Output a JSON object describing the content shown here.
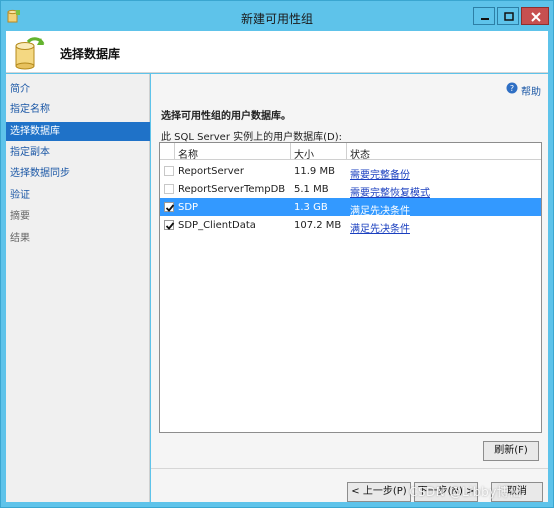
{
  "window": {
    "title": "新建可用性组"
  },
  "header": {
    "title": "选择数据库"
  },
  "sidebar": {
    "items": [
      {
        "label": "简介",
        "state": "link"
      },
      {
        "label": "指定名称",
        "state": "link"
      },
      {
        "label": "选择数据库",
        "state": "selected"
      },
      {
        "label": "指定副本",
        "state": "link"
      },
      {
        "label": "选择数据同步",
        "state": "link"
      },
      {
        "label": "验证",
        "state": "link"
      },
      {
        "label": "摘要",
        "state": "disabled"
      },
      {
        "label": "结果",
        "state": "disabled"
      }
    ]
  },
  "main": {
    "help_label": "帮助",
    "heading": "选择可用性组的用户数据库。",
    "grid_label": "此 SQL Server 实例上的用户数据库(D):",
    "columns": {
      "name": "名称",
      "size": "大小",
      "status": "状态"
    },
    "rows": [
      {
        "checked": false,
        "enabled": false,
        "name": "ReportServer",
        "size": "11.9 MB",
        "status": "需要完整备份",
        "selected": false
      },
      {
        "checked": false,
        "enabled": false,
        "name": "ReportServerTempDB",
        "size": "5.1 MB",
        "status": "需要完整恢复模式",
        "selected": false
      },
      {
        "checked": true,
        "enabled": true,
        "name": "SDP",
        "size": "1.3 GB",
        "status": "满足先决条件",
        "selected": true
      },
      {
        "checked": true,
        "enabled": true,
        "name": "SDP_ClientData",
        "size": "107.2 MB",
        "status": "满足先决条件",
        "selected": false
      }
    ],
    "refresh_label": "刷新(F)"
  },
  "footer": {
    "prev_label": "< 上一步(P)",
    "next_label": "下一步(N) >",
    "finish_label": "取消",
    "watermark": "CSDN @Libby博仙"
  },
  "colors": {
    "titlebar": "#5ec3ea",
    "selection": "#1f72c8",
    "row_selection": "#3399ff",
    "link": "#1c58a6"
  }
}
